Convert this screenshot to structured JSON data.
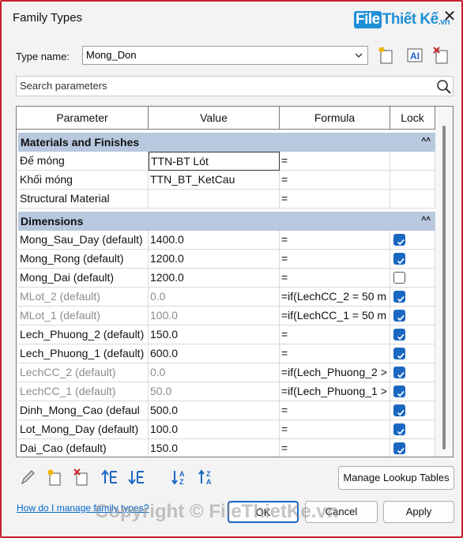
{
  "window": {
    "title": "Family Types",
    "close_glyph": "✕"
  },
  "logo": {
    "text": "FileThietKe",
    "f": "File",
    "rest": "Thiết Kế",
    "suffix": ".vn"
  },
  "type_name": {
    "label": "Type name:",
    "value": "Mong_Don"
  },
  "search": {
    "placeholder": "Search parameters"
  },
  "table": {
    "headers": [
      "Parameter",
      "Value",
      "Formula",
      "Lock"
    ],
    "sections": [
      {
        "title": "Materials and Finishes",
        "collapse": "˄˄"
      },
      {
        "title": "Dimensions",
        "collapse": "˄˄"
      }
    ],
    "materials": [
      {
        "param": "Đế móng",
        "value": "TTN-BT Lót",
        "formula": "="
      },
      {
        "param": "Khối móng",
        "value": "TTN_BT_KetCau",
        "formula": "="
      },
      {
        "param": "Structural Material",
        "value": "",
        "formula": "="
      }
    ],
    "dimensions": [
      {
        "param": "Mong_Sau_Day (default)",
        "value": "1400.0",
        "formula": "=",
        "lock": true,
        "gray": false
      },
      {
        "param": "Mong_Rong (default)",
        "value": "1200.0",
        "formula": "=",
        "lock": true,
        "gray": false
      },
      {
        "param": "Mong_Dai (default)",
        "value": "1200.0",
        "formula": "=",
        "lock": false,
        "gray": false
      },
      {
        "param": "MLot_2 (default)",
        "value": "0.0",
        "formula": "=if(LechCC_2 = 50 m",
        "lock": true,
        "gray": true
      },
      {
        "param": "MLot_1 (default)",
        "value": "100.0",
        "formula": "=if(LechCC_1 = 50 m",
        "lock": true,
        "gray": true
      },
      {
        "param": "Lech_Phuong_2 (default)",
        "value": "150.0",
        "formula": "=",
        "lock": true,
        "gray": false
      },
      {
        "param": "Lech_Phuong_1 (default)",
        "value": "600.0",
        "formula": "=",
        "lock": true,
        "gray": false
      },
      {
        "param": "LechCC_2 (default)",
        "value": "0.0",
        "formula": "=if(Lech_Phuong_2 >",
        "lock": true,
        "gray": true
      },
      {
        "param": "LechCC_1 (default)",
        "value": "50.0",
        "formula": "=if(Lech_Phuong_1 >",
        "lock": true,
        "gray": true
      },
      {
        "param": "Dinh_Mong_Cao (defaul",
        "value": "500.0",
        "formula": "=",
        "lock": true,
        "gray": false
      },
      {
        "param": "Lot_Mong_Day (default)",
        "value": "100.0",
        "formula": "=",
        "lock": true,
        "gray": false
      },
      {
        "param": "Dai_Cao (default)",
        "value": "150.0",
        "formula": "=",
        "lock": true,
        "gray": false
      }
    ]
  },
  "buttons": {
    "manage_lookup": "Manage Lookup Tables",
    "ok": "OK",
    "cancel": "Cancel",
    "apply": "Apply"
  },
  "help_link": "How do I manage family types?",
  "watermark": "Copyright © FileThietKe.vn",
  "colors": {
    "accent": "#1a67c1",
    "section_bg": "#b7c8df",
    "frame": "#c8202c",
    "logo": "#1f8fd6"
  },
  "icons": [
    "new-type-icon",
    "rename-type-icon",
    "search-icon",
    "edit-parameter-icon",
    "new-parameter-icon",
    "delete-parameter-icon",
    "move-up-icon",
    "move-down-icon",
    "sort-ascending-icon",
    "sort-descending-icon"
  ]
}
